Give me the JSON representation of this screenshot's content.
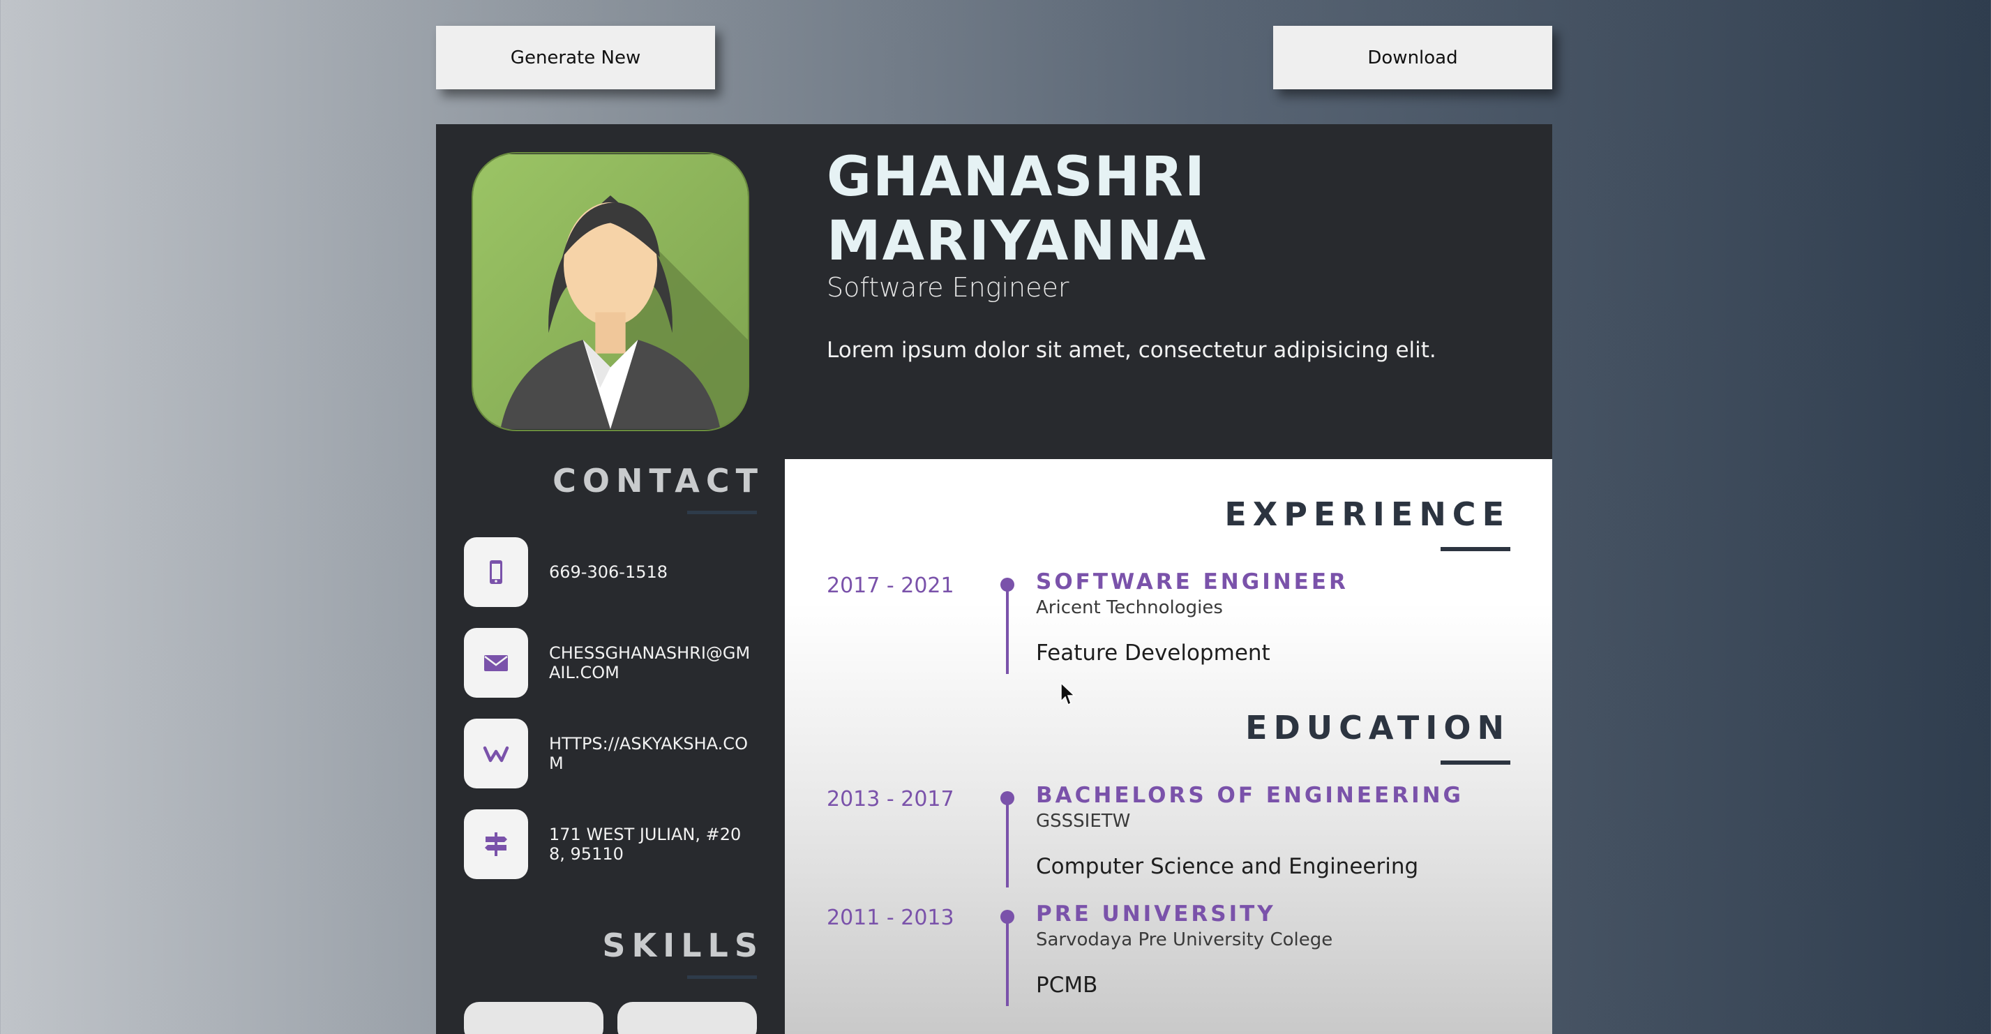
{
  "toolbar": {
    "generate_label": "Generate New",
    "download_label": "Download"
  },
  "profile": {
    "name_line1": "GHANASHRI",
    "name_line2": "MARIYANNA",
    "role": "Software Engineer",
    "summary": "Lorem ipsum dolor sit amet, consectetur adipisicing elit."
  },
  "contact": {
    "heading": "CONTACT",
    "items": [
      {
        "icon": "phone-icon",
        "text": "669-306-1518"
      },
      {
        "icon": "email-icon",
        "text": "CHESSGHANASHRI@GMAIL.COM"
      },
      {
        "icon": "website-icon",
        "text": "HTTPS://ASKYAKSHA.COM"
      },
      {
        "icon": "address-signpost-icon",
        "text": "171 WEST JULIAN, #208, 95110"
      }
    ]
  },
  "skills": {
    "heading": "SKILLS"
  },
  "experience": {
    "heading": "EXPERIENCE",
    "items": [
      {
        "dates": "2017 - 2021",
        "title": "SOFTWARE ENGINEER",
        "org": "Aricent Technologies",
        "desc": "Feature Development"
      }
    ]
  },
  "education": {
    "heading": "EDUCATION",
    "items": [
      {
        "dates": "2013 - 2017",
        "title": "BACHELORS OF ENGINEERING",
        "org": "GSSSIETW",
        "desc": "Computer Science and Engineering"
      },
      {
        "dates": "2011 - 2013",
        "title": "PRE UNIVERSITY",
        "org": "Sarvodaya Pre University Colege",
        "desc": "PCMB"
      }
    ]
  },
  "colors": {
    "accent": "#7a52aa",
    "sidebar": "#282a2e",
    "heading_dark": "#2c3440"
  }
}
